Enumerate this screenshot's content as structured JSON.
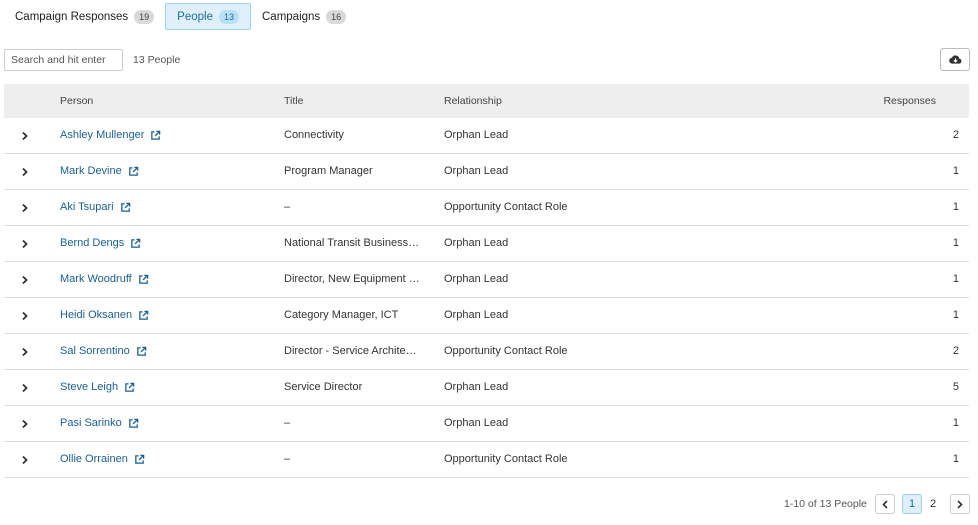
{
  "tabs": [
    {
      "label": "Campaign Responses",
      "count": "19"
    },
    {
      "label": "People",
      "count": "13"
    },
    {
      "label": "Campaigns",
      "count": "16"
    }
  ],
  "toolbar": {
    "search_placeholder": "Search and hit enter",
    "search_value": "",
    "count_label": "13 People",
    "download_icon": "cloud-download-icon"
  },
  "table": {
    "headers": {
      "person": "Person",
      "title": "Title",
      "relationship": "Relationship",
      "responses": "Responses"
    },
    "rows": [
      {
        "person": "Ashley Mullenger",
        "title": "Connectivity",
        "relationship": "Orphan Lead",
        "responses": "2"
      },
      {
        "person": "Mark Devine",
        "title": "Program Manager",
        "relationship": "Orphan Lead",
        "responses": "1"
      },
      {
        "person": "Aki Tsupari",
        "title": "–",
        "relationship": "Opportunity Contact Role",
        "responses": "1"
      },
      {
        "person": "Bernd Dengs",
        "title": "National Transit Business…",
        "relationship": "Orphan Lead",
        "responses": "1"
      },
      {
        "person": "Mark Woodruff",
        "title": "Director, New Equipment …",
        "relationship": "Orphan Lead",
        "responses": "1"
      },
      {
        "person": "Heidi Oksanen",
        "title": "Category Manager, ICT",
        "relationship": "Orphan Lead",
        "responses": "1"
      },
      {
        "person": "Sal Sorrentino",
        "title": "Director - Service Archite…",
        "relationship": "Opportunity Contact Role",
        "responses": "2"
      },
      {
        "person": "Steve Leigh",
        "title": "Service Director",
        "relationship": "Orphan Lead",
        "responses": "5"
      },
      {
        "person": "Pasi Sarinko",
        "title": "–",
        "relationship": "Orphan Lead",
        "responses": "1"
      },
      {
        "person": "Ollie Orrainen",
        "title": "–",
        "relationship": "Opportunity Contact Role",
        "responses": "1"
      }
    ]
  },
  "pagination": {
    "label": "1-10 of 13 People",
    "pages": [
      "1",
      "2"
    ],
    "current_page": "1"
  },
  "colors": {
    "accent": "#1a6fa8",
    "link": "#1a5f93",
    "active_tab_bg": "#dff0fb",
    "header_bg": "#eeeeee"
  }
}
